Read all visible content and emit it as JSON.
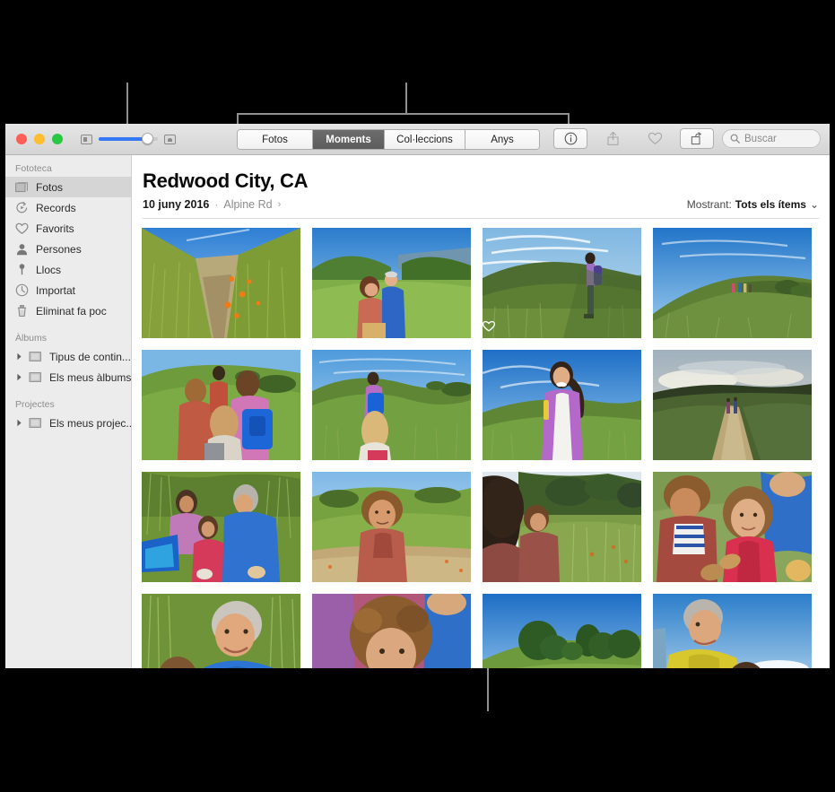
{
  "window": {
    "traffic_lights": [
      "close",
      "minimize",
      "maximize"
    ],
    "zoom_slider": {
      "small_icon": "small-thumbnail-icon",
      "large_icon": "large-thumbnail-icon",
      "value_percent": 82
    },
    "segmented_control": {
      "items": [
        {
          "label": "Fotos",
          "active": false
        },
        {
          "label": "Moments",
          "active": true
        },
        {
          "label": "Col·leccions",
          "active": false
        },
        {
          "label": "Anys",
          "active": false
        }
      ]
    },
    "toolbar_right": [
      {
        "name": "info-icon",
        "label": "Informació"
      },
      {
        "name": "share-icon",
        "label": "Compartir"
      },
      {
        "name": "heart-icon",
        "label": "Favorit"
      },
      {
        "name": "rotate-icon",
        "label": "Girar"
      }
    ],
    "search": {
      "icon": "search-icon",
      "placeholder": "Buscar",
      "value": ""
    }
  },
  "sidebar": {
    "sections": [
      {
        "header": "Fototeca",
        "items": [
          {
            "label": "Fotos",
            "icon": "photos-icon",
            "selected": true,
            "disclosure": false
          },
          {
            "label": "Records",
            "icon": "memories-icon",
            "selected": false,
            "disclosure": false
          },
          {
            "label": "Favorits",
            "icon": "heart-icon",
            "selected": false,
            "disclosure": false
          },
          {
            "label": "Persones",
            "icon": "person-icon",
            "selected": false,
            "disclosure": false
          },
          {
            "label": "Llocs",
            "icon": "map-pin-icon",
            "selected": false,
            "disclosure": false
          },
          {
            "label": "Importat",
            "icon": "clock-icon",
            "selected": false,
            "disclosure": false
          },
          {
            "label": "Eliminat fa poc",
            "icon": "trash-icon",
            "selected": false,
            "disclosure": false
          }
        ]
      },
      {
        "header": "Àlbums",
        "items": [
          {
            "label": "Tipus de contin...",
            "icon": "folder-icon",
            "selected": false,
            "disclosure": true
          },
          {
            "label": "Els meus àlbums",
            "icon": "folder-icon",
            "selected": false,
            "disclosure": true
          }
        ]
      },
      {
        "header": "Projectes",
        "items": [
          {
            "label": "Els meus projec...",
            "icon": "folder-icon",
            "selected": false,
            "disclosure": true
          }
        ]
      }
    ]
  },
  "main": {
    "title": "Redwood City, CA",
    "date": "10 juny 2016",
    "separator": "·",
    "place": "Alpine Rd",
    "place_chevron": "›",
    "showing_label": "Mostrant:",
    "showing_value": "Tots els ítems",
    "showing_chevron": "⌄"
  },
  "photos": [
    {
      "id": "p1",
      "description": "Grassy trail with orange poppies and blue sky",
      "favorite": false
    },
    {
      "id": "p2",
      "description": "Couple embracing in green meadow",
      "favorite": false
    },
    {
      "id": "p3",
      "description": "Woman with backpack standing on hillside",
      "favorite": true
    },
    {
      "id": "p4",
      "description": "Hikers walking along grassy ridge",
      "favorite": false
    },
    {
      "id": "p5",
      "description": "Children hiking up green hill from behind",
      "favorite": false
    },
    {
      "id": "p6",
      "description": "Two girls with blue backpack walking uphill",
      "favorite": false
    },
    {
      "id": "p7",
      "description": "Girl in purple jacket smiling on hillside",
      "favorite": false
    },
    {
      "id": "p8",
      "description": "Two hikers on dirt path under cloudy sky",
      "favorite": false
    },
    {
      "id": "p9",
      "description": "Man and two girls sitting in tall grass",
      "favorite": false
    },
    {
      "id": "p10",
      "description": "Curly haired boy in red hoodie on trail",
      "favorite": false
    },
    {
      "id": "p11",
      "description": "Woman and child facing trees in meadow",
      "favorite": false
    },
    {
      "id": "p12",
      "description": "Close-up of two children with snacks",
      "favorite": false
    },
    {
      "id": "p13",
      "description": "Smiling man in blue shirt in tall grass",
      "favorite": false
    },
    {
      "id": "p14",
      "description": "Close-up of curly haired child",
      "favorite": false
    },
    {
      "id": "p15",
      "description": "Green hilltop with trees under blue sky",
      "favorite": false
    },
    {
      "id": "p16",
      "description": "Man in yellow shirt with child and sky",
      "favorite": false
    }
  ],
  "annotations": {
    "callouts": [
      {
        "name": "sidebar-callout",
        "orientation": "vertical"
      },
      {
        "name": "view-tabs-callout",
        "orientation": "bracket"
      },
      {
        "name": "photo-grid-callout",
        "orientation": "vertical"
      }
    ]
  },
  "colors": {
    "accent_blue": "#3478f6",
    "window_chrome": "#e6e6e6",
    "sidebar_bg": "#ececec",
    "sidebar_selected": "#d5d5d5",
    "segment_active": "#5c5c5c",
    "backdrop": "#000000",
    "callout_line": "#8f8f8f"
  }
}
